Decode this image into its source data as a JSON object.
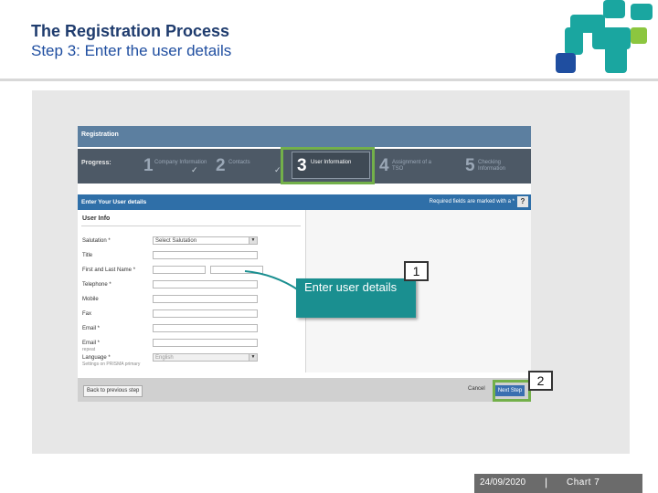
{
  "slide": {
    "title": "The Registration Process",
    "subtitle": "Step 3: Enter the user details"
  },
  "app": {
    "title": "Registration",
    "progress_label": "Progress:",
    "steps": [
      {
        "number": "1",
        "label": "Company Information",
        "completed": true
      },
      {
        "number": "2",
        "label": "Contacts",
        "completed": true
      },
      {
        "number": "3",
        "label": "User Information",
        "active": true
      },
      {
        "number": "4",
        "label": "Assignment of a TSO"
      },
      {
        "number": "5",
        "label": "Checking Information"
      }
    ],
    "section_title": "Enter Your User details",
    "required_note": "Required fields are marked with a *",
    "help_label": "?",
    "form_heading": "User Info",
    "fields": {
      "salutation_label": "Salutation *",
      "salutation_value": "Select Salutation",
      "title_label": "Title",
      "name_label": "First and Last Name *",
      "telephone_label": "Telephone *",
      "mobile_label": "Mobile",
      "fax_label": "Fax",
      "email_label": "Email *",
      "email_repeat_label": "Email *",
      "email_repeat_sub": "repeat",
      "language_label": "Language *",
      "language_sub": "Settings on PRISMA primary",
      "language_value": "English"
    },
    "buttons": {
      "back": "Back to previous step",
      "cancel": "Cancel",
      "next": "Next Step"
    }
  },
  "callouts": {
    "enter_details": "Enter user details",
    "badge_1": "1",
    "badge_2": "2"
  },
  "footer": {
    "date": "24/09/2020",
    "separator": "|",
    "page": "Chart 7"
  },
  "colors": {
    "title": "#1f3c6e",
    "callout": "#1a8f90",
    "highlight": "#73b04a",
    "logo_blue": "#1f4ea0",
    "logo_teal": "#1aa6a0",
    "logo_green": "#8cc63f"
  }
}
